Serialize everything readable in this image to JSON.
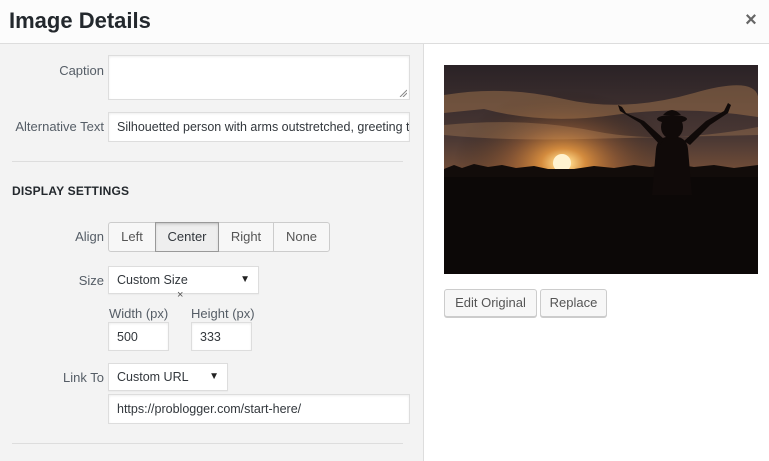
{
  "header": {
    "title": "Image Details",
    "close_glyph": "×"
  },
  "caption": {
    "label": "Caption",
    "value": ""
  },
  "alt_text": {
    "label": "Alternative Text",
    "value": "Silhouetted person with arms outstretched, greeting t"
  },
  "display": {
    "section_title": "DISPLAY SETTINGS",
    "align": {
      "label": "Align",
      "options": [
        "Left",
        "Center",
        "Right",
        "None"
      ],
      "selected": "Center"
    },
    "size": {
      "label": "Size",
      "selected": "Custom Size",
      "width_label": "Width (px)",
      "height_label": "Height (px)",
      "width_value": "500",
      "height_value": "333",
      "times_glyph": "×"
    },
    "link": {
      "label": "Link To",
      "selected": "Custom URL",
      "url": "https://problogger.com/start-here/"
    }
  },
  "preview": {
    "edit_original_label": "Edit Original",
    "replace_label": "Replace"
  },
  "icons": {
    "close": "close-icon",
    "dropdown": "chevron-down-icon",
    "resize": "resize-grip-icon"
  },
  "colors": {
    "panel_bg": "#f3f3f3",
    "border": "#dddddd",
    "text": "#23282d"
  }
}
